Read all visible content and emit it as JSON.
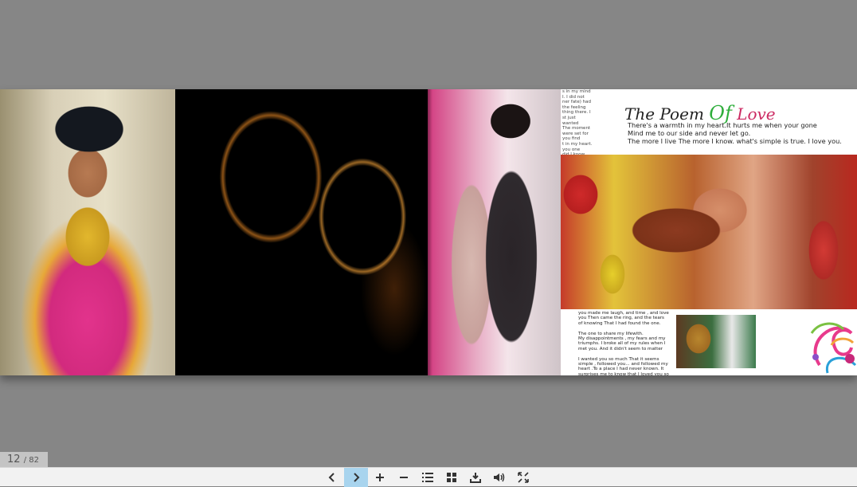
{
  "page_counter": {
    "current": "12",
    "total_label": "/ 82"
  },
  "album": {
    "poem_title_part1": "The Poem ",
    "poem_title_of": "Of",
    "poem_title_love": " Love",
    "poem_lines": [
      "There's a warmth in my heart.It hurts me when your gone",
      "Mind me to our side and never let go.",
      "The more I live The more I know. what's simple is true. I love you."
    ],
    "left_strip_text": "s in my mind\nI. I did not\nner fate) had\nthe feeling\nthing there. I\nst just wanted\nThe moment\nwere set for\nyou find\nt in my heart.\nyou one\ndid I know\nyou you\nhen the tears of\ning there\n, and love\nmy lifewith.",
    "bottom_text": "you made me laugh, and time , and love you Then came the ring, and the tears of knowing That I had found the one.\n\nThe one to share my lifewith.\nMy disappointments , my fears and my triumphs. I broke all of my rules when I met you. And it didn't seem to matter\n\nI wanted you so much That it seems simple , followed you... and followed my heart .To a place I had never known. It surprises me to know that I loved you so much then . And it is even deeper still. How I bless that day when we met .It was meant to be. God ( or destiny ) had His way ,And I am so glad He did."
  },
  "toolbar": {
    "buttons": [
      {
        "name": "previous-page",
        "icon": "chevron-left-icon"
      },
      {
        "name": "next-page",
        "icon": "chevron-right-icon",
        "active": true
      },
      {
        "name": "zoom-in",
        "icon": "plus-icon"
      },
      {
        "name": "zoom-out",
        "icon": "minus-icon"
      },
      {
        "name": "table-of-contents",
        "icon": "list-icon"
      },
      {
        "name": "thumbnails",
        "icon": "grid-icon"
      },
      {
        "name": "download",
        "icon": "download-icon"
      },
      {
        "name": "sound",
        "icon": "volume-icon"
      },
      {
        "name": "fullscreen",
        "icon": "fullscreen-icon"
      }
    ],
    "active_color": "#a8d4ee"
  }
}
